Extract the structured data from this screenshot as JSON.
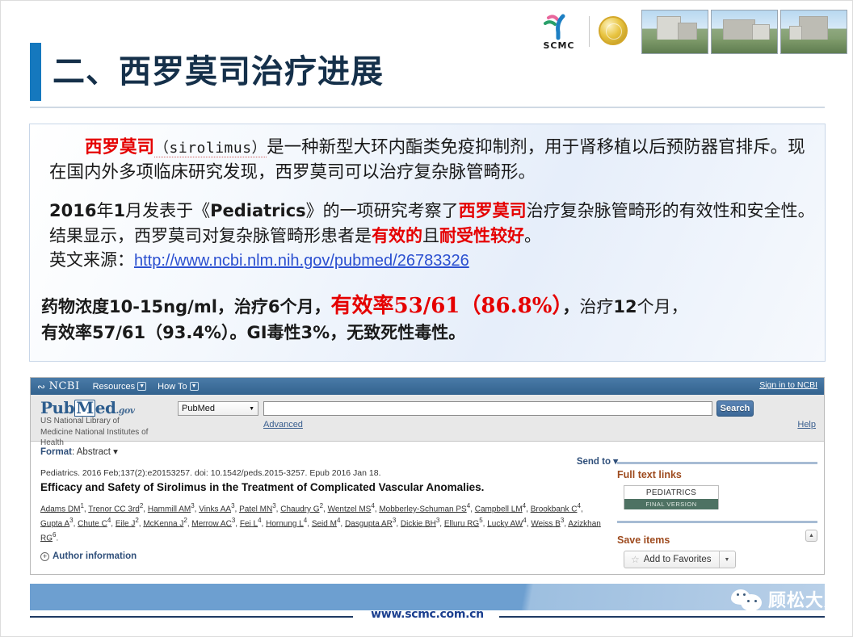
{
  "header": {
    "title": "二、西罗莫司治疗进展",
    "accent_color": "#1578be",
    "title_color": "#15304a",
    "logo": {
      "wordmark": "SCMC",
      "medal_caption": ""
    },
    "photos": [
      "hospital-photo-1",
      "hospital-photo-2",
      "hospital-photo-3"
    ]
  },
  "content": {
    "paragraph1": {
      "term": "西罗莫司",
      "latin": "（sirolimus）",
      "rest": "是一种新型大环内酯类免疫抑制剂，用于肾移植以后预防器官排斥。现在国内外多项临床研究发现，西罗莫司可以治疗复杂脉管畸形。"
    },
    "paragraph2": {
      "lead": "2016",
      "seg1": "年",
      "month": "1",
      "seg2": "月发表于《",
      "journal": "Pediatrics",
      "seg3": "》的一项研究考察了",
      "drug": "西罗莫司",
      "seg4": "治疗复杂脉管畸形的有效性和安全性。结果显示，西罗莫司对复杂脉管畸形患者是",
      "red1": "有效的",
      "seg5": "且",
      "red2": "耐受性较好",
      "seg6": "。",
      "source_label": "英文来源：",
      "source_url": "http://www.ncbi.nlm.nih.gov/pubmed/26783326"
    },
    "paragraph3": {
      "seg1": "药物浓度",
      "dose": "10-15ng/ml",
      "seg2": "，治疗",
      "months1": "6",
      "seg3": "个月，",
      "highlight": "有效率53/61（86.8%）",
      "seg4": "，",
      "seg5": "治疗",
      "months2": "12",
      "seg6": "个月，",
      "seg7": "有效率",
      "rate2": "57/61（93.4%）",
      "seg8": "。",
      "gi": "GI",
      "seg9": "毒性",
      "gi_rate": "3%",
      "seg10": "，无致死性毒性。"
    },
    "highlight_color": "#e50000"
  },
  "pubmed": {
    "ncbi": {
      "brand": "NCBI",
      "menu": [
        "Resources",
        "How To"
      ],
      "signin": "Sign in to NCBI"
    },
    "logo": {
      "pub": "Pub",
      "m": "M",
      "ed": "ed",
      "gov": ".gov"
    },
    "subtitle": "US National Library of Medicine National Institutes of Health",
    "search": {
      "database": "PubMed",
      "query": "",
      "placeholder": "",
      "button": "Search",
      "advanced": "Advanced",
      "help": "Help"
    },
    "format": {
      "label": "Format",
      "value": "Abstract"
    },
    "send_to": "Send to",
    "citation": "Pediatrics. 2016 Feb;137(2):e20153257. doi: 10.1542/peds.2015-3257. Epub 2016 Jan 18.",
    "citation_journal": "Pediatrics.",
    "article_title": "Efficacy and Safety of Sirolimus in the Treatment of Complicated Vascular Anomalies.",
    "authors": [
      {
        "name": "Adams DM",
        "sup": "1"
      },
      {
        "name": "Trenor CC 3rd",
        "sup": "2"
      },
      {
        "name": "Hammill AM",
        "sup": "3"
      },
      {
        "name": "Vinks AA",
        "sup": "3"
      },
      {
        "name": "Patel MN",
        "sup": "3"
      },
      {
        "name": "Chaudry G",
        "sup": "2"
      },
      {
        "name": "Wentzel MS",
        "sup": "4"
      },
      {
        "name": "Mobberley-Schuman PS",
        "sup": "4"
      },
      {
        "name": "Campbell LM",
        "sup": "4"
      },
      {
        "name": "Brookbank C",
        "sup": "4"
      },
      {
        "name": "Gupta A",
        "sup": "3"
      },
      {
        "name": "Chute C",
        "sup": "4"
      },
      {
        "name": "Eile J",
        "sup": "2"
      },
      {
        "name": "McKenna J",
        "sup": "2"
      },
      {
        "name": "Merrow AC",
        "sup": "3"
      },
      {
        "name": "Fei L",
        "sup": "4"
      },
      {
        "name": "Hornung L",
        "sup": "4"
      },
      {
        "name": "Seid M",
        "sup": "4"
      },
      {
        "name": "Dasgupta AR",
        "sup": "3"
      },
      {
        "name": "Dickie BH",
        "sup": "3"
      },
      {
        "name": "Elluru RG",
        "sup": "5"
      },
      {
        "name": "Lucky AW",
        "sup": "4"
      },
      {
        "name": "Weiss B",
        "sup": "3"
      },
      {
        "name": "Azizkhan RG",
        "sup": "6"
      }
    ],
    "author_information": "Author information",
    "sidebar": {
      "full_text_links_title": "Full text links",
      "provider_name": "PEDIATRICS",
      "provider_tag": "FINAL VERSION",
      "save_items_title": "Save items",
      "favorites_button": "Add to Favorites"
    }
  },
  "footer": {
    "url": "www.scmc.com.cn",
    "wechat_name": "顾松大夫"
  }
}
